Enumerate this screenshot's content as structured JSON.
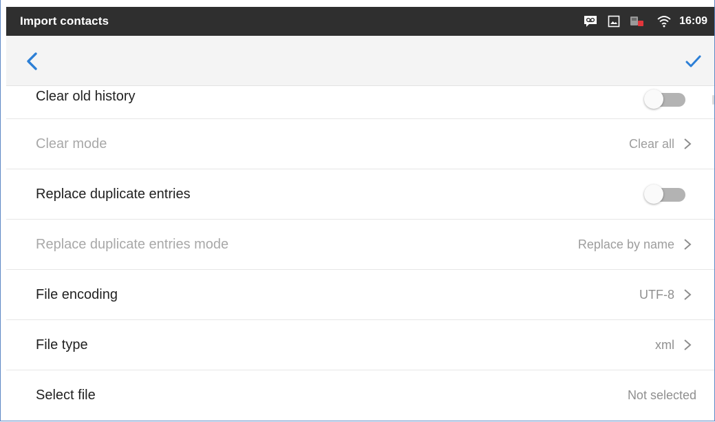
{
  "status_bar": {
    "title": "Import contacts",
    "time": "16:09",
    "icons": [
      "voicemail-icon",
      "image-icon",
      "phone-missed-icon",
      "wifi-icon"
    ]
  },
  "app_bar": {
    "back_icon": "chevron-left-icon",
    "confirm_icon": "checkmark-icon",
    "accent_color": "#2c7fd6"
  },
  "settings": [
    {
      "label": "Clear old history",
      "type": "toggle",
      "on": false
    },
    {
      "label": "Clear mode",
      "type": "select",
      "value": "Clear all",
      "disabled": true
    },
    {
      "label": "Replace duplicate entries",
      "type": "toggle",
      "on": false
    },
    {
      "label": "Replace duplicate entries mode",
      "type": "select",
      "value": "Replace by name",
      "disabled": true
    },
    {
      "label": "File encoding",
      "type": "select",
      "value": "UTF-8"
    },
    {
      "label": "File type",
      "type": "select",
      "value": "xml"
    },
    {
      "label": "Select file",
      "type": "action",
      "value": "Not selected"
    }
  ]
}
